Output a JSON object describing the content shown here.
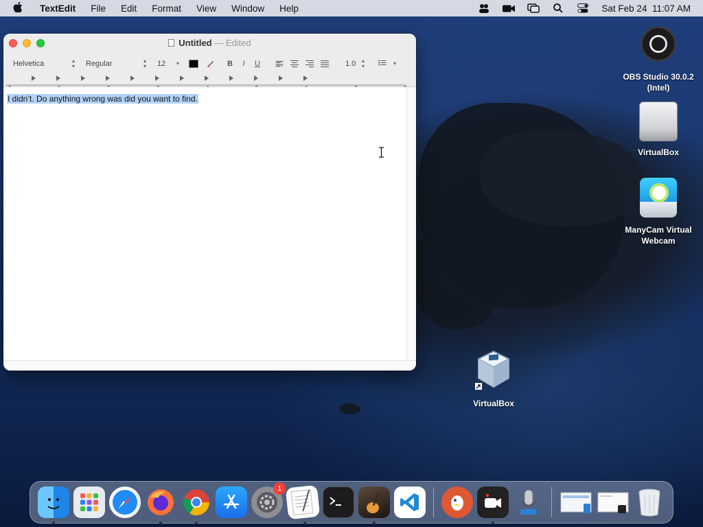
{
  "menubar": {
    "app_name": "TextEdit",
    "menus": [
      "File",
      "Edit",
      "Format",
      "View",
      "Window",
      "Help"
    ],
    "clock": "Sat Feb 24  11:07 AM"
  },
  "window": {
    "title": "Untitled",
    "separator": "—",
    "status": "Edited",
    "toolbar": {
      "font_family": "Helvetica",
      "font_style": "Regular",
      "font_size": "12",
      "bold": "B",
      "italic": "I",
      "underline": "U",
      "line_spacing": "1.0"
    },
    "ruler_numbers": [
      "0",
      "1",
      "2",
      "3",
      "4",
      "5",
      "6",
      "7",
      "8"
    ],
    "document_text": "I didn’t. Do anything wrong was did you want to find."
  },
  "desktop_icons": [
    {
      "label_line1": "OBS Studio 30.0.2",
      "label_line2": "(Intel)"
    },
    {
      "label_line1": "VirtualBox",
      "label_line2": ""
    },
    {
      "label_line1": "ManyCam Virtual",
      "label_line2": "Webcam"
    },
    {
      "label_line1": "VirtualBox",
      "label_line2": ""
    }
  ],
  "dock": {
    "settings_badge": "1"
  },
  "colors": {
    "selection": "#b3d2f7",
    "close": "#fe5f57",
    "minimize": "#febc2e",
    "zoom": "#28c840"
  }
}
